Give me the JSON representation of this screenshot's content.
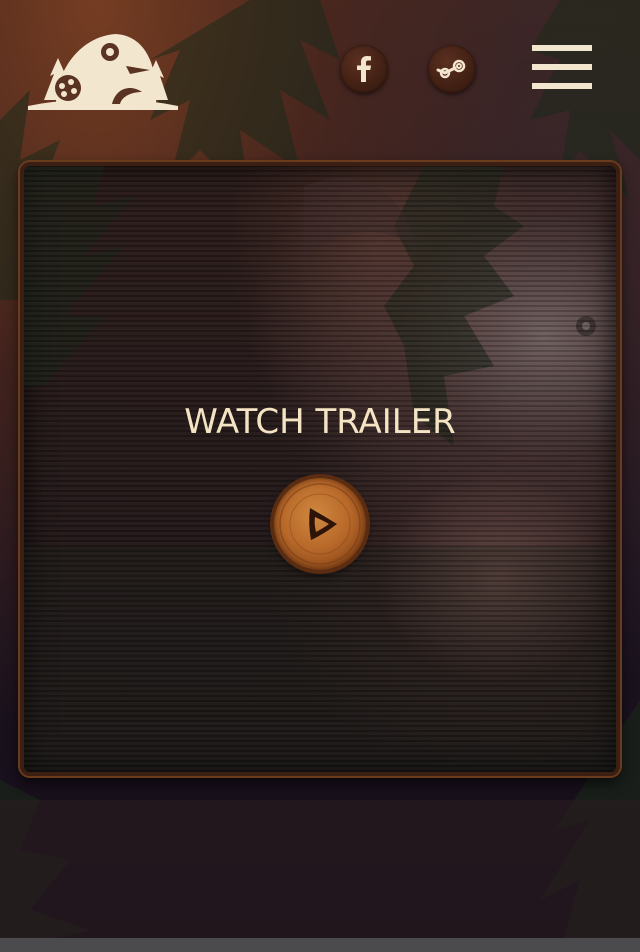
{
  "header": {
    "logo_icon": "mushroom-house-logo",
    "social": [
      {
        "name": "facebook",
        "icon": "facebook-icon"
      },
      {
        "name": "steam",
        "icon": "steam-icon"
      }
    ],
    "menu_icon": "hamburger-menu-icon"
  },
  "trailer": {
    "title": "WATCH TRAILER",
    "play_icon": "play-icon"
  },
  "colors": {
    "text_cream": "#f4e4c4",
    "social_bg": "#3d1d12",
    "play_wood": "#b8692a",
    "panel_border": "#3a1f12"
  }
}
